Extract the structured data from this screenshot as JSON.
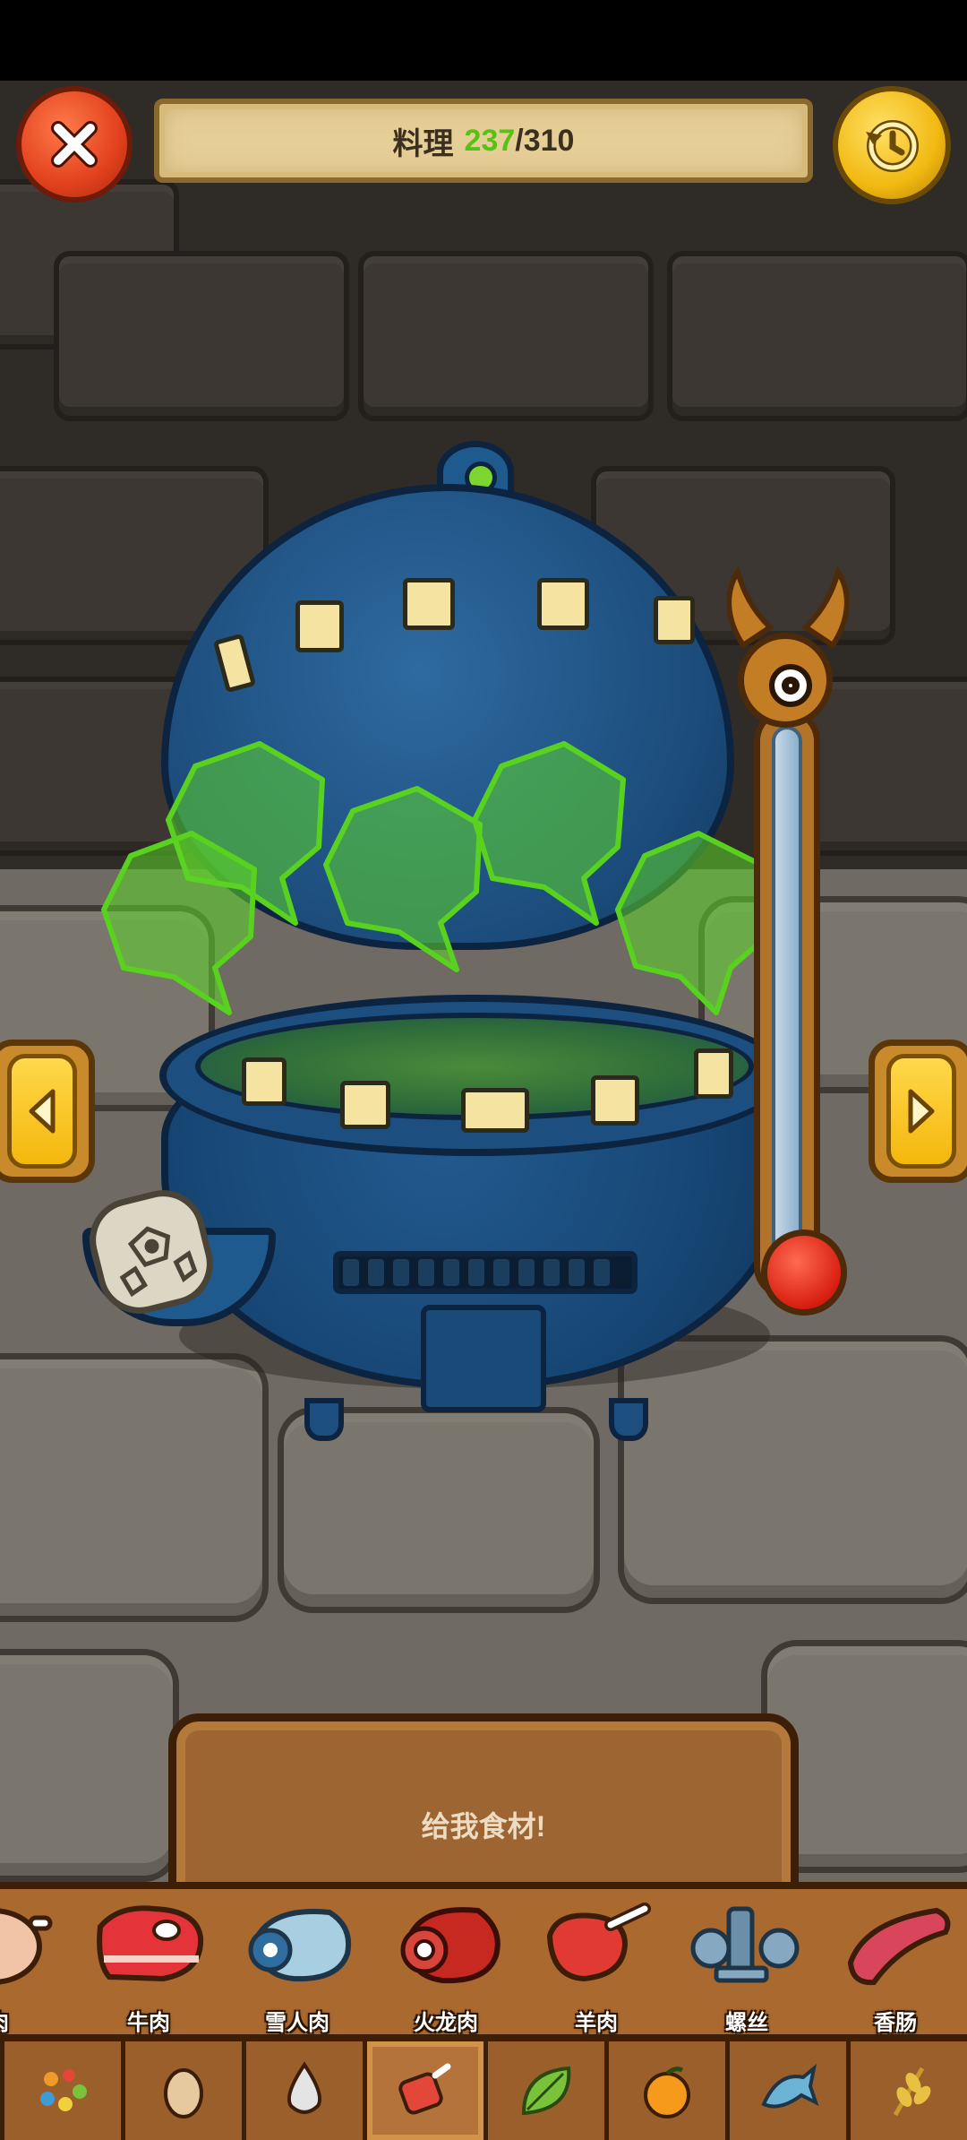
{
  "header": {
    "title_label": "料理",
    "count_current": "237",
    "count_separator": "/",
    "count_total": "310"
  },
  "board": {
    "message": "给我食材!"
  },
  "ingredients": [
    {
      "name": "肉",
      "icon": "drumstick-icon"
    },
    {
      "name": "牛肉",
      "icon": "beef-steak-icon"
    },
    {
      "name": "雪人肉",
      "icon": "yeti-meat-icon"
    },
    {
      "name": "火龙肉",
      "icon": "dragon-meat-icon"
    },
    {
      "name": "羊肉",
      "icon": "lamb-chop-icon"
    },
    {
      "name": "螺丝",
      "icon": "screws-icon"
    },
    {
      "name": "香肠",
      "icon": "sausage-icon"
    }
  ],
  "tabs": [
    {
      "icon": "mixed-ingredients-icon",
      "active": false
    },
    {
      "icon": "egg-icon",
      "active": false
    },
    {
      "icon": "drop-icon",
      "active": false
    },
    {
      "icon": "meat-icon",
      "active": true
    },
    {
      "icon": "leaf-icon",
      "active": false
    },
    {
      "icon": "orange-icon",
      "active": false
    },
    {
      "icon": "fish-icon",
      "active": false
    },
    {
      "icon": "wheat-icon",
      "active": false
    }
  ],
  "colors": {
    "count_current": "#58c214",
    "steam": "#5fd62a",
    "cauldron": "#1b4b7a"
  }
}
